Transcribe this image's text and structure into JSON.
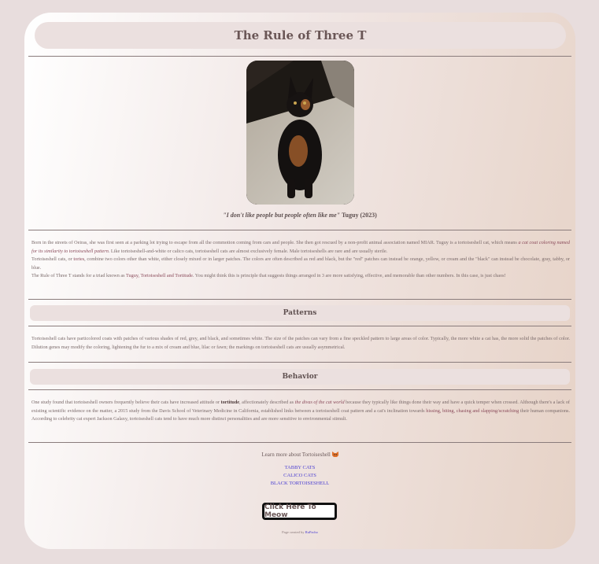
{
  "page": {
    "title": "The Rule of Three T"
  },
  "hero": {
    "caption_quote": "\"I don't like people but people often like me\"",
    "caption_author": "Tuguy (2023)"
  },
  "intro": {
    "p1_a": "Born in the streets of Oeiras, she was first seen at a parking lot trying to escape from all the commotion coming from cars and people. She then got rescued by a non-profit animal association named MIAR. Tuguy is a tortoiseshell cat, which means ",
    "p1_em": "a cat coat coloring named for its similarity to tortoiseshell pattern",
    "p1_b": ". Like tortoiseshell-and-white or calico cats, tortoiseshell cats are almost exclusively female. Male tortoiseshells are rare and are usually sterile.",
    "p2_a": "Tortoiseshell cats, or ",
    "p2_hl": "tories",
    "p2_b": ", combine two colors other than white, either closely mixed or in larger patches. The colors are often described as red and black, but the \"red\" patches can instead be orange, yellow, or cream and the \"black\" can instead be chocolate, gray, tabby, or blue.",
    "p3_a": "The Rule of Three T stands for a triad known as ",
    "p3_hl": "Tuguy, Tortoiseshell and Tortitude",
    "p3_b": ". You might think this is principle that suggests things arranged in 3 are more satisfying, effective, and memorable than other numbers. In this case, is just chaos!"
  },
  "patterns": {
    "heading": "Patterns",
    "text": "Tortoiseshell cats have particolored coats with patches of various shades of red, grey, and black, and sometimes white. The size of the patches can vary from a fine speckled pattern to large areas of color. Typically, the more white a cat has, the more solid the patches of color. Dilution genes may modify the coloring, lightening the fur to a mix of cream and blue, lilac or fawn; the markings on tortoiseshell cats are usually asymmetrical."
  },
  "behavior": {
    "heading": "Behavior",
    "t1": "One study found that tortoiseshell owners frequently believe their cats have increased attitude or ",
    "strong": "tortitude",
    "t2": ", affectionately described as ",
    "em": "the divas of the cat world",
    "t3": " because they typically like things done their way and have a quick temper when crossed. Although there's a lack of existing scientific evidence on the matter, a 2015 study from the Davis School of Veterinary Medicine in California, established links between a tortoiseshell coat pattern and a cat's inclination towards ",
    "hl": "hissing, biting, chasing and slapping/scratching",
    "t4": " their human companions. According to celebrity cat expert Jackson Galaxy, tortoiseshell cats tend to have much more distinct personalities and are more sensitive to environmental stimuli."
  },
  "footer": {
    "learn_more": "Learn more about Tortoiseshell",
    "learn_icon": "cat-face-icon",
    "links": [
      "TABBY CATS",
      "CALICO CATS",
      "BLACK TORTOISESHELL"
    ],
    "button_label": "Click Here To Meow",
    "credit_prefix": "Page created by",
    "credit_name": "RuPacho"
  }
}
